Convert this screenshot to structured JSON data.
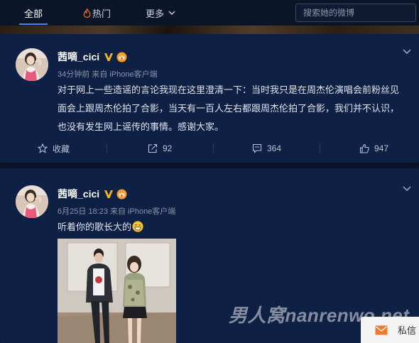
{
  "nav": {
    "tabs": [
      {
        "label": "全部",
        "icon": null
      },
      {
        "label": "热门",
        "icon": "fire-icon"
      },
      {
        "label": "更多",
        "icon": "chevron-down-icon"
      }
    ],
    "search_placeholder": "搜索她的微博",
    "accent": "#3d85ff"
  },
  "posts": [
    {
      "username": "茜嘀_cici",
      "meta": "34分钟前 来自 iPhone客户端",
      "text": "对于网上一些造谣的言论我现在这里澄清一下：当时我只是在周杰伦演唱会前粉丝见面会上跟周杰伦拍了合影，当天有一百人左右都跟周杰伦拍了合影，我们并不认识，也没有发生网上谣传的事情。感谢大家。",
      "actions": {
        "favorite": "收藏",
        "repost": "92",
        "comment": "364",
        "like": "947"
      }
    },
    {
      "username": "茜嘀_cici",
      "meta": "6月25日 18:23 来自 iPhone客户端",
      "text": "听着你的歌长大的",
      "emoji": "grin-emoji"
    }
  ],
  "watermark": "男人窝nanrenwo.net",
  "message_float": {
    "label": "私信"
  }
}
